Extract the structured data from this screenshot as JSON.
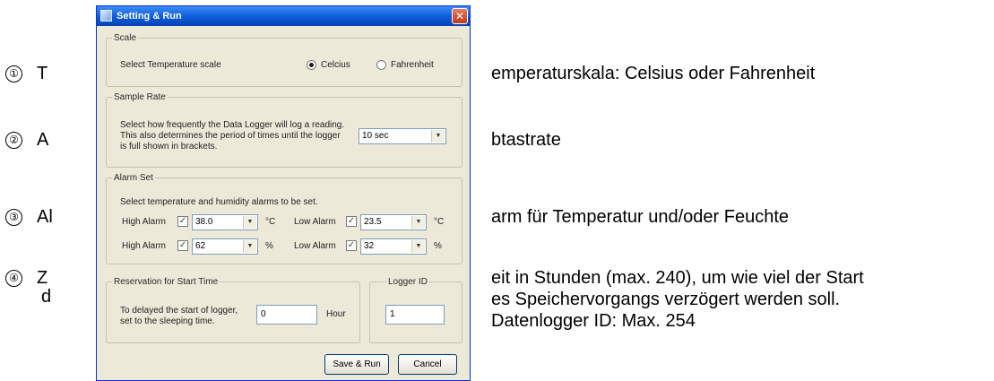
{
  "annotations": [
    {
      "num": "①",
      "letter": "T",
      "text": "emperaturskala: Celsius oder Fahrenheit"
    },
    {
      "num": "②",
      "letter": "A",
      "text": "btastrate"
    },
    {
      "num": "③",
      "letter": "Al",
      "text": "arm für Temperatur und/oder Feuchte"
    },
    {
      "num": "④",
      "letter": "Z",
      "letter2": "d",
      "lines": [
        "eit in Stunden (max. 240), um wie viel der Start",
        "es Speichervorgangs verzögert werden soll.",
        "Datenlogger ID: Max. 254"
      ]
    }
  ],
  "dialog": {
    "title": "Setting & Run",
    "close_symbol": "✕",
    "scale": {
      "legend": "Scale",
      "label": "Select Temperature scale",
      "options": [
        "Celcius",
        "Fahrenheit"
      ],
      "selected": "Celcius"
    },
    "sample_rate": {
      "legend": "Sample Rate",
      "lines": [
        "Select how frequently the Data Logger will log a reading.",
        "This also determines the period of times until the logger",
        "is full shown in brackets."
      ],
      "value": "10 sec"
    },
    "alarm": {
      "legend": "Alarm Set",
      "description": "Select temperature and humidity alarms to be set.",
      "high_label": "High Alarm",
      "low_label": "Low Alarm",
      "temp_high": "38.0",
      "temp_low": "23.5",
      "temp_unit": "°C",
      "hum_high": "62",
      "hum_low": "32",
      "hum_unit": "%"
    },
    "reservation": {
      "legend": "Reservation for Start Time",
      "lines": [
        "To delayed the start of logger,",
        "set to the sleeping time."
      ],
      "value": "0",
      "unit": "Hour"
    },
    "logger": {
      "legend": "Logger ID",
      "value": "1"
    },
    "buttons": {
      "save": "Save & Run",
      "cancel": "Cancel"
    },
    "check_mark": "✓",
    "dropdown_arrow": "▼"
  }
}
